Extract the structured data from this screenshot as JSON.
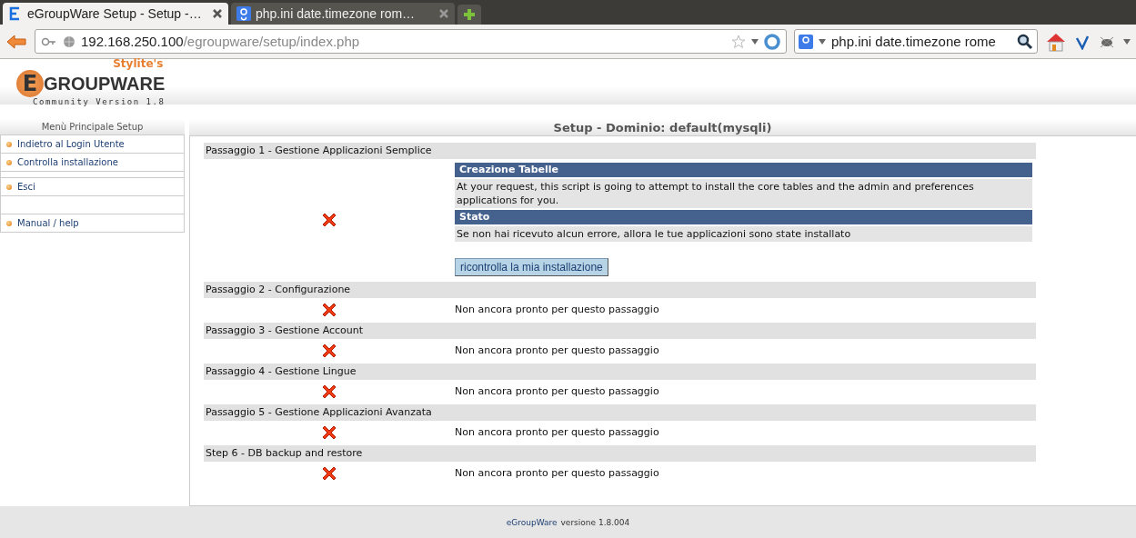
{
  "browser": {
    "tabs": [
      {
        "title": "eGroupWare Setup - Setup -…",
        "selected": true,
        "kind": "egw"
      },
      {
        "title": "php.ini date.timezone rom…",
        "selected": false,
        "kind": "google"
      }
    ],
    "address": {
      "host": "192.168.250.100",
      "path": "/egroupware/setup/index.php"
    },
    "search": {
      "value": "php.ini date.timezone rome"
    }
  },
  "logo": {
    "tagline": "Stylite's",
    "letter": "E",
    "name": "GROUPWARE",
    "version": "Community Version 1.8"
  },
  "sidebar": {
    "title": "Menù Principale Setup",
    "items": [
      {
        "kind": "link",
        "label": "Indietro al Login Utente"
      },
      {
        "kind": "link",
        "label": "Controlla installazione"
      },
      {
        "kind": "divider"
      },
      {
        "kind": "link",
        "label": "Esci"
      },
      {
        "kind": "spacer"
      },
      {
        "kind": "link",
        "label": "Manual / help"
      }
    ]
  },
  "main": {
    "title": "Setup - Dominio: default(mysqli)",
    "steps": [
      {
        "title": "Passaggio 1 - Gestione Applicazioni Semplice",
        "failed": true,
        "details": {
          "sections": [
            {
              "heading": "Creazione Tabelle",
              "text": "At your request, this script is going to attempt to install the core tables and the admin and preferences applications for you."
            },
            {
              "heading": "Stato",
              "text": "Se non hai ricevuto alcun errore, allora le tue applicazioni sono state installato"
            }
          ],
          "button": "ricontrolla la mia installazione"
        }
      },
      {
        "title": "Passaggio 2 - Configurazione",
        "failed": true,
        "message": "Non ancora pronto per questo passaggio"
      },
      {
        "title": "Passaggio 3 - Gestione Account",
        "failed": true,
        "message": "Non ancora pronto per questo passaggio"
      },
      {
        "title": "Passaggio 4 - Gestione Lingue",
        "failed": true,
        "message": "Non ancora pronto per questo passaggio"
      },
      {
        "title": "Passaggio 5 - Gestione Applicazioni Avanzata",
        "failed": true,
        "message": "Non ancora pronto per questo passaggio"
      },
      {
        "title": "Step 6 - DB backup and restore",
        "failed": true,
        "message": "Non ancora pronto per questo passaggio"
      }
    ]
  },
  "footer": {
    "link": "eGroupWare",
    "text": "versione 1.8.004"
  }
}
